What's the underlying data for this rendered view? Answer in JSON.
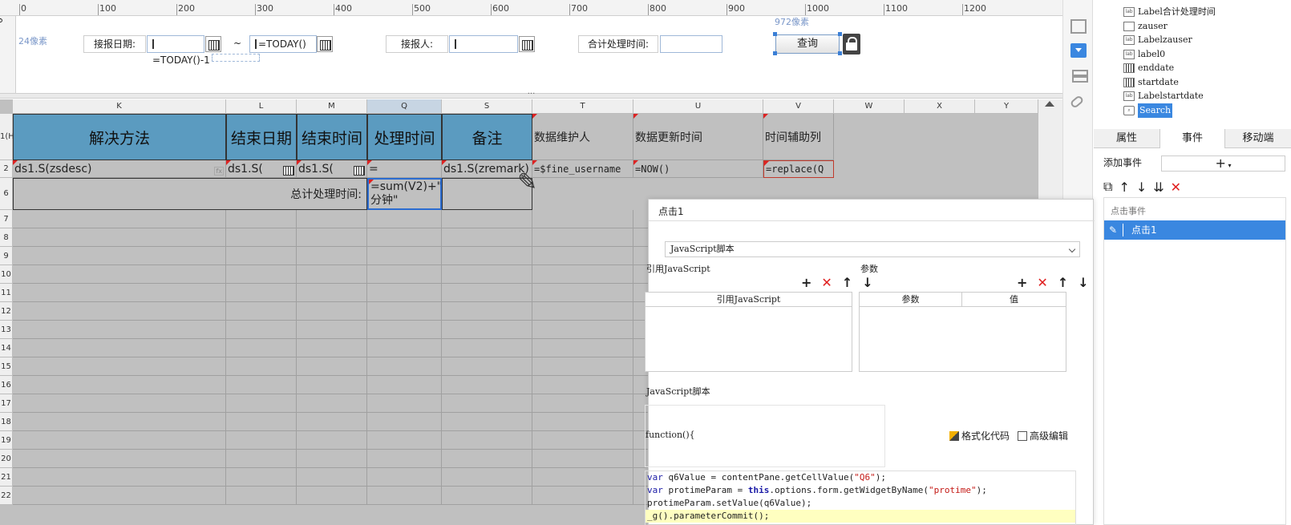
{
  "ruler": {
    "ticks": [
      "0",
      "100",
      "200",
      "300",
      "400",
      "500",
      "600",
      "700",
      "800",
      "900",
      "1000",
      "1100",
      "1200"
    ],
    "vertical_tick": "0"
  },
  "designer": {
    "px_hint_left": "24像素",
    "px_hint_top": "972像素",
    "report_date_label": "接报日期:",
    "start_date_value": "=TODAY()-1",
    "range_separator": "~",
    "end_date_value": "=TODAY()",
    "reporter_label": "接报人:",
    "reporter_value": "",
    "total_time_label": "合计处理时间:",
    "total_time_value": "",
    "query_button": "查询"
  },
  "sheet": {
    "columns": [
      "K",
      "L",
      "M",
      "Q",
      "S",
      "T",
      "U",
      "V",
      "W",
      "X",
      "Y"
    ],
    "rows": [
      "1(H)",
      "2",
      "6",
      "7",
      "8",
      "9",
      "10",
      "11",
      "12",
      "13",
      "14",
      "15",
      "16",
      "17",
      "18",
      "19",
      "20",
      "21",
      "22"
    ],
    "header_row": [
      "解决方法",
      "结束日期",
      "结束时间",
      "处理时间",
      "备注",
      "数据维护人",
      "数据更新时间",
      "时间辅助列"
    ],
    "data_row": [
      "ds1.S(zsdesc)",
      "ds1.S(",
      "ds1.S(",
      "=",
      "ds1.S(zremark)",
      "=$fine_username",
      "=NOW()",
      "=replace(Q"
    ],
    "total_label": "总计处理时间:",
    "total_formula_line1": "=sum(V2)+\"",
    "total_formula_line2": "分钟\""
  },
  "widget_tree": {
    "items": [
      {
        "icon": "Lab",
        "label": "Label合计处理时间"
      },
      {
        "icon": "text",
        "label": "zauser"
      },
      {
        "icon": "Lab",
        "label": "Labelzauser"
      },
      {
        "icon": "Lab",
        "label": "label0"
      },
      {
        "icon": "date",
        "label": "enddate"
      },
      {
        "icon": "date",
        "label": "startdate"
      },
      {
        "icon": "Lab",
        "label": "Labelstartdate"
      },
      {
        "icon": "search",
        "label": "Search"
      }
    ]
  },
  "panel": {
    "tabs": [
      "属性",
      "事件",
      "移动端"
    ],
    "active_tab": "事件",
    "add_event_label": "添加事件",
    "add_symbol": "+",
    "event_group": "点击事件",
    "selected_event": "点击1"
  },
  "dialog": {
    "title": "点击1",
    "script_type": "JavaScript脚本",
    "ref_js_label": "引用JavaScript",
    "param_label": "参数",
    "ref_js_header": "引用JavaScript",
    "param_col": "参数",
    "value_col": "值",
    "js_section_label": "JavaScript脚本",
    "function_sig": "function(){",
    "format_code": "格式化代码",
    "advanced_edit": "高级编辑"
  },
  "code_lines": [
    "var q6Value = contentPane.getCellValue(\"Q6\");",
    "var protimeParam = this.options.form.getWidgetByName(\"protime\");",
    "protimeParam.setValue(q6Value);",
    "_g().parameterCommit();"
  ],
  "colors": {
    "header_cell": "#5b9bc0",
    "sheet_bg": "#c0c0c0",
    "selection_blue": "#3a87e0",
    "delete_red": "#e02020"
  }
}
